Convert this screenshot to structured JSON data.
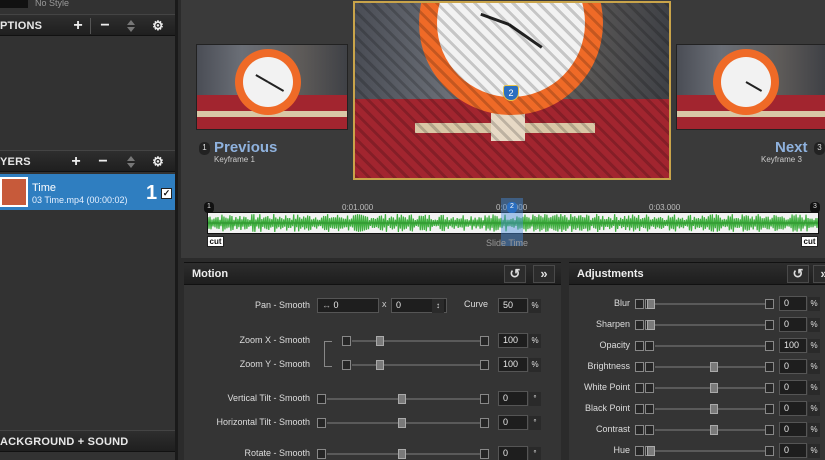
{
  "left_panel": {
    "top_style": "No Style",
    "options_header": "PTIONS",
    "layers_header": "YERS",
    "bg_sound_header": "ACKGROUND + SOUND",
    "layer": {
      "name": "Time",
      "file": "03 Time.mp4 (00:00:02)",
      "number": "1",
      "checked": "✓"
    }
  },
  "preview": {
    "previous_label": "Previous",
    "previous_sub": "Keyframe 1",
    "next_label": "Next",
    "next_sub": "Keyframe 3",
    "prev_marker": "1",
    "next_marker": "3",
    "center_keyframe": "2"
  },
  "timeline": {
    "ticks": [
      "0:01.000",
      "0:02.000",
      "0:03.000"
    ],
    "start_marker": "1",
    "mid_marker": "2",
    "end_marker": "3",
    "cut_left": "cut",
    "cut_right": "cut",
    "slide_label": "Slide Time"
  },
  "motion": {
    "title": "Motion",
    "pan_label": "Pan - Smooth",
    "pan_x": "0",
    "pan_y": "0",
    "x_sep": "x",
    "curve_label": "Curve",
    "curve_value": "50",
    "zoom_x_label": "Zoom X - Smooth",
    "zoom_x_value": "100",
    "zoom_y_label": "Zoom Y - Smooth",
    "zoom_y_value": "100",
    "vtilt_label": "Vertical Tilt - Smooth",
    "vtilt_value": "0",
    "htilt_label": "Horizontal Tilt - Smooth",
    "htilt_value": "0",
    "rotate_label": "Rotate - Smooth",
    "rotate_value": "0",
    "percent": "%",
    "degree": "°"
  },
  "adjustments": {
    "title": "Adjustments",
    "rows": [
      {
        "label": "Blur",
        "value": "0",
        "unit": "%"
      },
      {
        "label": "Sharpen",
        "value": "0",
        "unit": "%"
      },
      {
        "label": "Opacity",
        "value": "100",
        "unit": "%"
      },
      {
        "label": "Brightness",
        "value": "0",
        "unit": "%"
      },
      {
        "label": "White Point",
        "value": "0",
        "unit": "%"
      },
      {
        "label": "Black Point",
        "value": "0",
        "unit": "%"
      },
      {
        "label": "Contrast",
        "value": "0",
        "unit": "%"
      },
      {
        "label": "Hue",
        "value": "0",
        "unit": "%"
      }
    ]
  },
  "colors": {
    "accent": "#2f7ec0",
    "nav_label": "#8fb2de",
    "waveform": "#3fae3f"
  }
}
